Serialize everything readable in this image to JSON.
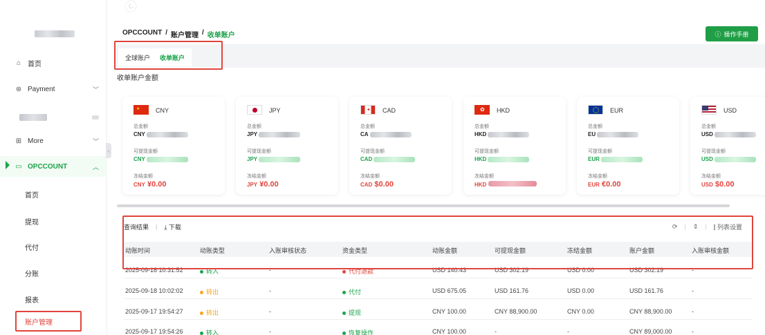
{
  "sidebar": {
    "home": "首页",
    "payment": "Payment",
    "more": "More",
    "opccount": "OPCCOUNT",
    "sub_items": [
      "首页",
      "提现",
      "代付",
      "分账",
      "报表",
      "账户管理"
    ]
  },
  "breadcrumb": [
    "OPCCOUNT",
    "/",
    "账户管理",
    "/",
    "收单账户"
  ],
  "help_button": "操作手册",
  "tabs": [
    "全球账户",
    "收单账户"
  ],
  "section_title": "收单账户金额",
  "labels": {
    "total": "总金额",
    "withdrawable": "可提现金额",
    "frozen": "冻结金额"
  },
  "cards": [
    {
      "code": "CNY",
      "prefix": "CNY",
      "frozen_code": "CNY",
      "frozen_value": "¥0.00"
    },
    {
      "code": "JPY",
      "prefix": "JPY",
      "frozen_code": "JPY",
      "frozen_value": "¥0.00"
    },
    {
      "code": "CAD",
      "prefix": "CAD",
      "frozen_code": "CAD",
      "frozen_value": "$0.00"
    },
    {
      "code": "HKD",
      "prefix": "HKD",
      "frozen_code": "HKD",
      "frozen_value": ""
    },
    {
      "code": "EUR",
      "prefix": "EUR",
      "frozen_code": "EUR",
      "frozen_value": "€0.00"
    },
    {
      "code": "USD",
      "prefix": "USD",
      "frozen_code": "USD",
      "frozen_value": "$0.00"
    }
  ],
  "card_prefix_visible": [
    "CNY",
    "JPY",
    "CA",
    "HKD",
    "EU",
    "USD"
  ],
  "card_withdraw_visible": [
    "CNY",
    "JPY",
    "CAD",
    "HKD",
    "EUR",
    "USD"
  ],
  "toolbar": {
    "results": "查询结果",
    "download": "下载",
    "columns": "列表设置"
  },
  "table": {
    "headers": [
      "动账时间",
      "动账类型",
      "入账审核状态",
      "资金类型",
      "动账金额",
      "可提现金额",
      "冻结金额",
      "账户金额",
      "入账审核金额"
    ],
    "rows": [
      [
        "2025-09-18 10:31:52",
        "转入",
        "-",
        "代付退款",
        "USD 140.43",
        "USD 302.19",
        "USD 0.00",
        "USD 302.19",
        "-"
      ],
      [
        "2025-09-18 10:02:02",
        "转出",
        "-",
        "代付",
        "USD 675.05",
        "USD 161.76",
        "USD 0.00",
        "USD 161.76",
        "-"
      ],
      [
        "2025-09-17 19:54:27",
        "转出",
        "-",
        "提现",
        "CNY 100.00",
        "CNY 88,900.00",
        "CNY 0.00",
        "CNY 88,900.00",
        "-"
      ],
      [
        "2025-09-17 19:54:26",
        "转入",
        "-",
        "恢复操作",
        "CNY 100.00",
        "-",
        "-",
        "CNY 89,000.00",
        "-"
      ]
    ],
    "type_colors": {
      "in": "#1aa34a",
      "out": "#f5a623"
    }
  }
}
